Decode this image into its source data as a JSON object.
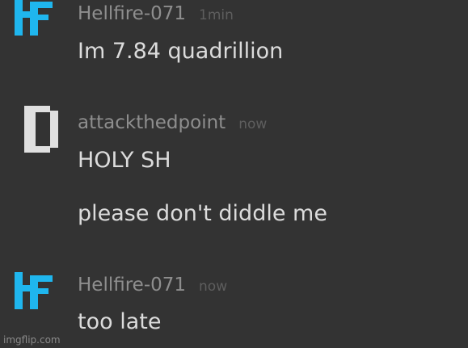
{
  "messages": [
    {
      "avatar_icon": "hf-logo-icon",
      "username": "Hellfire-071",
      "timestamp": "1min",
      "lines": [
        "Im 7.84 quadrillion"
      ]
    },
    {
      "avatar_icon": "pixel-d-logo-icon",
      "username": "attackthedpoint",
      "timestamp": "now",
      "lines": [
        "HOLY SH",
        "please don't diddle me"
      ]
    },
    {
      "avatar_icon": "hf-logo-icon",
      "username": "Hellfire-071",
      "timestamp": "now",
      "lines": [
        "too late"
      ]
    }
  ],
  "colors": {
    "background": "#333333",
    "username": "#8e8e8e",
    "timestamp": "#5e5e5e",
    "message_text": "#dcdcdc",
    "hf_logo": "#1fb6ee",
    "d_logo": "#e0e0e0"
  },
  "watermark": "imgflip.com"
}
